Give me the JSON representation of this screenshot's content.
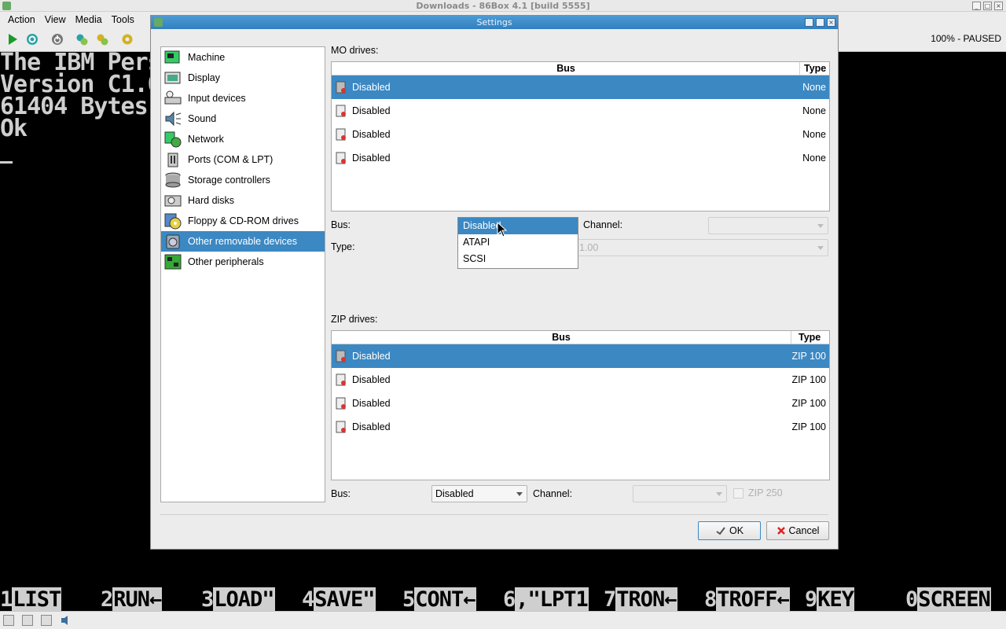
{
  "main_window": {
    "title": "Downloads - 86Box 4.1 [build 5555]",
    "menu": [
      {
        "label": "Action"
      },
      {
        "label": "View"
      },
      {
        "label": "Media"
      },
      {
        "label": "Tools"
      }
    ],
    "status_text": "100% - PAUSED"
  },
  "screen": {
    "lines": [
      "The IBM Pers",
      "Version C1.0",
      "61404 Bytes",
      "Ok"
    ],
    "function_keys": [
      {
        "num": "1",
        "label": "LIST"
      },
      {
        "num": "2",
        "label": "RUN←"
      },
      {
        "num": "3",
        "label": "LOAD\""
      },
      {
        "num": "4",
        "label": "SAVE\""
      },
      {
        "num": "5",
        "label": "CONT←"
      },
      {
        "num": "6",
        "label": ",\"LPT1"
      },
      {
        "num": "7",
        "label": "TRON←"
      },
      {
        "num": "8",
        "label": "TROFF←"
      },
      {
        "num": "9",
        "label": "KEY"
      },
      {
        "num": "0",
        "label": "SCREEN"
      }
    ]
  },
  "dialog": {
    "title": "Settings",
    "nav": [
      {
        "label": "Machine",
        "icon": "machine-icon"
      },
      {
        "label": "Display",
        "icon": "display-icon"
      },
      {
        "label": "Input devices",
        "icon": "input-devices-icon"
      },
      {
        "label": "Sound",
        "icon": "sound-icon"
      },
      {
        "label": "Network",
        "icon": "network-icon"
      },
      {
        "label": "Ports (COM & LPT)",
        "icon": "ports-icon"
      },
      {
        "label": "Storage controllers",
        "icon": "storage-controllers-icon"
      },
      {
        "label": "Hard disks",
        "icon": "hard-disks-icon"
      },
      {
        "label": "Floppy & CD-ROM drives",
        "icon": "floppy-cdrom-icon"
      },
      {
        "label": "Other removable devices",
        "icon": "removable-devices-icon",
        "selected": true
      },
      {
        "label": "Other peripherals",
        "icon": "peripherals-icon"
      }
    ],
    "mo": {
      "section_label": "MO drives:",
      "col_bus": "Bus",
      "col_type": "Type",
      "rows": [
        {
          "bus": "Disabled",
          "type": "None",
          "selected": true
        },
        {
          "bus": "Disabled",
          "type": "None"
        },
        {
          "bus": "Disabled",
          "type": "None"
        },
        {
          "bus": "Disabled",
          "type": "None"
        }
      ],
      "bus_label": "Bus:",
      "channel_label": "Channel:",
      "type_label": "Type:",
      "type_value_partial": "1.00",
      "bus_options": [
        "Disabled",
        "ATAPI",
        "SCSI"
      ],
      "bus_selected": "Disabled"
    },
    "zip": {
      "section_label": "ZIP drives:",
      "col_bus": "Bus",
      "col_type": "Type",
      "rows": [
        {
          "bus": "Disabled",
          "type": "ZIP 100",
          "selected": true
        },
        {
          "bus": "Disabled",
          "type": "ZIP 100"
        },
        {
          "bus": "Disabled",
          "type": "ZIP 100"
        },
        {
          "bus": "Disabled",
          "type": "ZIP 100"
        }
      ],
      "bus_label": "Bus:",
      "bus_value": "Disabled",
      "channel_label": "Channel:",
      "zip250_label": "ZIP 250"
    },
    "ok_label": "OK",
    "cancel_label": "Cancel"
  }
}
